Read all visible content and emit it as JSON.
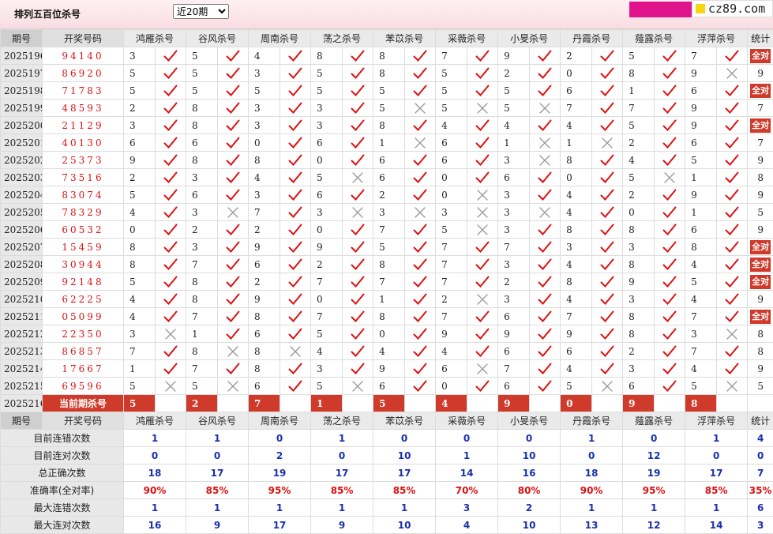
{
  "title": "排列五百位杀号",
  "period_select": {
    "options": [
      "近20期"
    ],
    "selected": "近20期"
  },
  "brand": {
    "text": "cz89.com",
    "accent": "#e0158d",
    "dot": "#f6d511"
  },
  "colors": {
    "check": "#d11",
    "cross": "#999",
    "badge": "#cf3a2b",
    "stat_blue": "#1a2fb0"
  },
  "header": {
    "period": "期号",
    "lottery": "开奖号码",
    "experts": [
      "鸿雁杀号",
      "谷风杀号",
      "周南杀号",
      "荡之杀号",
      "苯苡杀号",
      "采薇杀号",
      "小旻杀号",
      "丹霞杀号",
      "薤露杀号",
      "浮萍杀号"
    ],
    "stats": "统计"
  },
  "rows": [
    {
      "period": "2025196",
      "number": "94140",
      "kills": [
        3,
        5,
        4,
        8,
        8,
        7,
        9,
        2,
        5,
        7
      ],
      "marks": [
        1,
        1,
        1,
        1,
        1,
        1,
        1,
        1,
        1,
        1
      ],
      "stat": "全对"
    },
    {
      "period": "2025197",
      "number": "86920",
      "kills": [
        5,
        5,
        3,
        5,
        8,
        5,
        2,
        0,
        8,
        9
      ],
      "marks": [
        1,
        1,
        1,
        1,
        1,
        1,
        1,
        1,
        1,
        0
      ],
      "stat": "9"
    },
    {
      "period": "2025198",
      "number": "71783",
      "kills": [
        5,
        5,
        5,
        5,
        5,
        5,
        5,
        6,
        1,
        6
      ],
      "marks": [
        1,
        1,
        1,
        1,
        1,
        1,
        1,
        1,
        1,
        1
      ],
      "stat": "全对"
    },
    {
      "period": "2025199",
      "number": "48593",
      "kills": [
        2,
        8,
        3,
        3,
        5,
        5,
        5,
        7,
        7,
        9
      ],
      "marks": [
        1,
        1,
        1,
        1,
        0,
        0,
        0,
        1,
        1,
        1
      ],
      "stat": "7"
    },
    {
      "period": "2025200",
      "number": "21129",
      "kills": [
        3,
        8,
        3,
        3,
        8,
        4,
        4,
        4,
        5,
        9
      ],
      "marks": [
        1,
        1,
        1,
        1,
        1,
        1,
        1,
        1,
        1,
        1
      ],
      "stat": "全对"
    },
    {
      "period": "2025201",
      "number": "40130",
      "kills": [
        6,
        6,
        0,
        6,
        1,
        6,
        1,
        1,
        2,
        6
      ],
      "marks": [
        1,
        1,
        1,
        1,
        0,
        1,
        0,
        0,
        1,
        1
      ],
      "stat": "7"
    },
    {
      "period": "2025202",
      "number": "25373",
      "kills": [
        9,
        8,
        8,
        0,
        6,
        6,
        3,
        8,
        4,
        5
      ],
      "marks": [
        1,
        1,
        1,
        1,
        1,
        1,
        0,
        1,
        1,
        1
      ],
      "stat": "9"
    },
    {
      "period": "2025203",
      "number": "73516",
      "kills": [
        2,
        3,
        4,
        5,
        6,
        0,
        6,
        0,
        5,
        1
      ],
      "marks": [
        1,
        1,
        1,
        0,
        1,
        1,
        1,
        1,
        0,
        1
      ],
      "stat": "8"
    },
    {
      "period": "2025204",
      "number": "83074",
      "kills": [
        5,
        6,
        3,
        6,
        2,
        0,
        3,
        4,
        2,
        9
      ],
      "marks": [
        1,
        1,
        1,
        1,
        1,
        0,
        1,
        1,
        1,
        1
      ],
      "stat": "9"
    },
    {
      "period": "2025205",
      "number": "78329",
      "kills": [
        4,
        3,
        7,
        3,
        3,
        3,
        3,
        4,
        0,
        1
      ],
      "marks": [
        1,
        0,
        1,
        0,
        0,
        0,
        0,
        1,
        1,
        1
      ],
      "stat": "5"
    },
    {
      "period": "2025206",
      "number": "60532",
      "kills": [
        0,
        2,
        2,
        0,
        7,
        5,
        3,
        8,
        8,
        6
      ],
      "marks": [
        1,
        1,
        1,
        1,
        1,
        0,
        1,
        1,
        1,
        1
      ],
      "stat": "9"
    },
    {
      "period": "2025207",
      "number": "15459",
      "kills": [
        8,
        3,
        9,
        9,
        5,
        7,
        7,
        3,
        3,
        8
      ],
      "marks": [
        1,
        1,
        1,
        1,
        1,
        1,
        1,
        1,
        1,
        1
      ],
      "stat": "全对"
    },
    {
      "period": "2025208",
      "number": "30944",
      "kills": [
        8,
        7,
        6,
        2,
        8,
        7,
        3,
        4,
        8,
        4
      ],
      "marks": [
        1,
        1,
        1,
        1,
        1,
        1,
        1,
        1,
        1,
        1
      ],
      "stat": "全对"
    },
    {
      "period": "2025209",
      "number": "92148",
      "kills": [
        5,
        8,
        2,
        7,
        7,
        7,
        2,
        8,
        9,
        5
      ],
      "marks": [
        1,
        1,
        1,
        1,
        1,
        1,
        1,
        1,
        1,
        1
      ],
      "stat": "全对"
    },
    {
      "period": "2025210",
      "number": "62225",
      "kills": [
        4,
        8,
        9,
        0,
        1,
        2,
        3,
        4,
        3,
        4
      ],
      "marks": [
        1,
        1,
        1,
        1,
        1,
        0,
        1,
        1,
        1,
        1
      ],
      "stat": "9"
    },
    {
      "period": "2025211",
      "number": "05099",
      "kills": [
        4,
        7,
        8,
        7,
        8,
        7,
        6,
        7,
        8,
        7
      ],
      "marks": [
        1,
        1,
        1,
        1,
        1,
        1,
        1,
        1,
        1,
        1
      ],
      "stat": "全对"
    },
    {
      "period": "2025212",
      "number": "22350",
      "kills": [
        3,
        1,
        6,
        5,
        0,
        9,
        9,
        9,
        8,
        3
      ],
      "marks": [
        0,
        1,
        1,
        1,
        1,
        1,
        1,
        1,
        1,
        0
      ],
      "stat": "8"
    },
    {
      "period": "2025213",
      "number": "86857",
      "kills": [
        7,
        8,
        8,
        4,
        4,
        4,
        6,
        6,
        2,
        7
      ],
      "marks": [
        1,
        0,
        0,
        1,
        1,
        1,
        1,
        1,
        1,
        1
      ],
      "stat": "8"
    },
    {
      "period": "2025214",
      "number": "17667",
      "kills": [
        1,
        7,
        8,
        3,
        9,
        6,
        7,
        4,
        3,
        4
      ],
      "marks": [
        1,
        1,
        1,
        1,
        1,
        0,
        1,
        1,
        1,
        1
      ],
      "stat": "9"
    },
    {
      "period": "2025215",
      "number": "69596",
      "kills": [
        5,
        5,
        6,
        5,
        6,
        0,
        6,
        5,
        6,
        5
      ],
      "marks": [
        0,
        0,
        1,
        0,
        1,
        1,
        1,
        0,
        1,
        0
      ],
      "stat": "5"
    }
  ],
  "current": {
    "period": "2025216",
    "label": "当前期杀号",
    "kills": [
      5,
      2,
      7,
      1,
      5,
      4,
      9,
      0,
      9,
      8
    ]
  },
  "summary": [
    {
      "label": "目前连错次数",
      "values": [
        "1",
        "1",
        "0",
        "1",
        "0",
        "0",
        "0",
        "1",
        "0",
        "1"
      ],
      "stat": "4"
    },
    {
      "label": "目前连对次数",
      "values": [
        "0",
        "0",
        "2",
        "0",
        "10",
        "1",
        "10",
        "0",
        "12",
        "0"
      ],
      "stat": "0"
    },
    {
      "label": "总正确次数",
      "values": [
        "18",
        "17",
        "19",
        "17",
        "17",
        "14",
        "16",
        "18",
        "19",
        "17"
      ],
      "stat": "7"
    },
    {
      "label": "准确率(全对率)",
      "values": [
        "90%",
        "85%",
        "95%",
        "85%",
        "85%",
        "70%",
        "80%",
        "90%",
        "95%",
        "85%"
      ],
      "stat": "35%"
    },
    {
      "label": "最大连错次数",
      "values": [
        "1",
        "1",
        "1",
        "1",
        "1",
        "3",
        "2",
        "1",
        "1",
        "1"
      ],
      "stat": "6"
    },
    {
      "label": "最大连对次数",
      "values": [
        "16",
        "9",
        "17",
        "9",
        "10",
        "4",
        "10",
        "13",
        "12",
        "14"
      ],
      "stat": "3"
    }
  ]
}
